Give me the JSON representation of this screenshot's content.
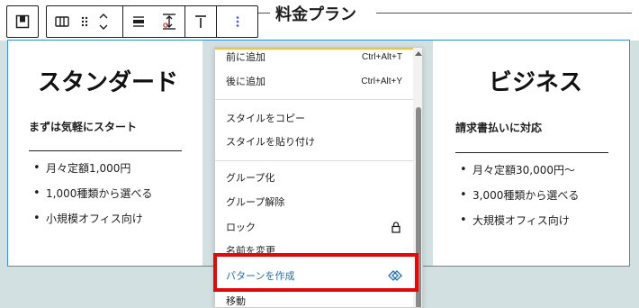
{
  "section": {
    "title": "料金プラン"
  },
  "toolbar": {
    "icons": [
      "parent-block-icon",
      "columns-block-icon",
      "drag-handle-icon",
      "move-up-down-icon",
      "align-icon",
      "vertical-align-icon",
      "justify-top-icon",
      "more-options-icon"
    ]
  },
  "cards": [
    {
      "heading": "スタンダード",
      "lead": "まずは気軽にスタート",
      "items": [
        "月々定額1,000円",
        "1,000種類から選べる",
        "小規模オフィス向け"
      ]
    },
    {
      "heading": "ビジネス",
      "lead": "請求書払いに対応",
      "items": [
        "月々定額30,000円〜",
        "3,000種類から選べる",
        "大規模オフィス向け"
      ]
    }
  ],
  "menu": {
    "items": [
      {
        "label": "前に追加",
        "shortcut": "Ctrl+Alt+T"
      },
      {
        "label": "後に追加",
        "shortcut": "Ctrl+Alt+Y"
      },
      {
        "label": "スタイルをコピー"
      },
      {
        "label": "スタイルを貼り付け"
      },
      {
        "label": "グループ化"
      },
      {
        "label": "グループ解除"
      },
      {
        "label": "ロック",
        "icon": "lock-icon"
      },
      {
        "label": "名前を変更"
      },
      {
        "label": "パターンを作成",
        "icon": "pattern-icon"
      },
      {
        "label": "移動"
      }
    ]
  },
  "colors": {
    "accent": "#3e8fd8",
    "highlight": "#e10a0a",
    "link": "#2271b1"
  }
}
